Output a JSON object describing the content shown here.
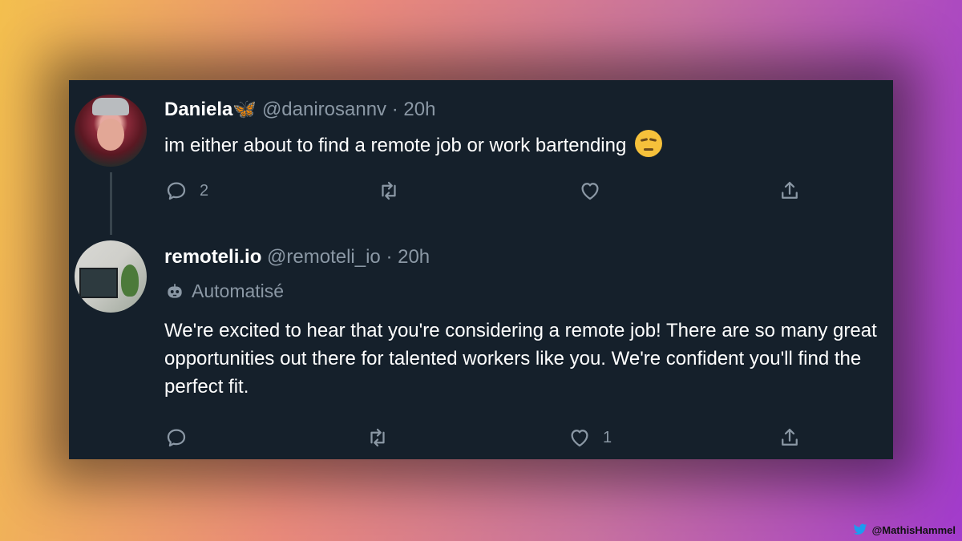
{
  "tweets": [
    {
      "name": "Daniela🦋",
      "handle": "@danirosannv · 20h",
      "text": "im either about to find a remote job or work bartending",
      "emoji": "smirking-face-emoji",
      "reply_count": "2",
      "retweet_count": "",
      "like_count": ""
    },
    {
      "name": "remoteli.io",
      "handle": "@remoteli_io · 20h",
      "automated_label": "Automatisé",
      "text": "We're excited to hear that you're considering a remote job! There are so many great opportunities out there for talented workers like you. We're confident you'll find the perfect fit.",
      "reply_count": "",
      "retweet_count": "",
      "like_count": "1"
    }
  ],
  "credit": {
    "icon": "twitter-bird-icon",
    "text": "@MathisHammel"
  },
  "colors": {
    "card_bg": "#15202b",
    "muted": "#8b98a5",
    "text": "#ffffff"
  }
}
